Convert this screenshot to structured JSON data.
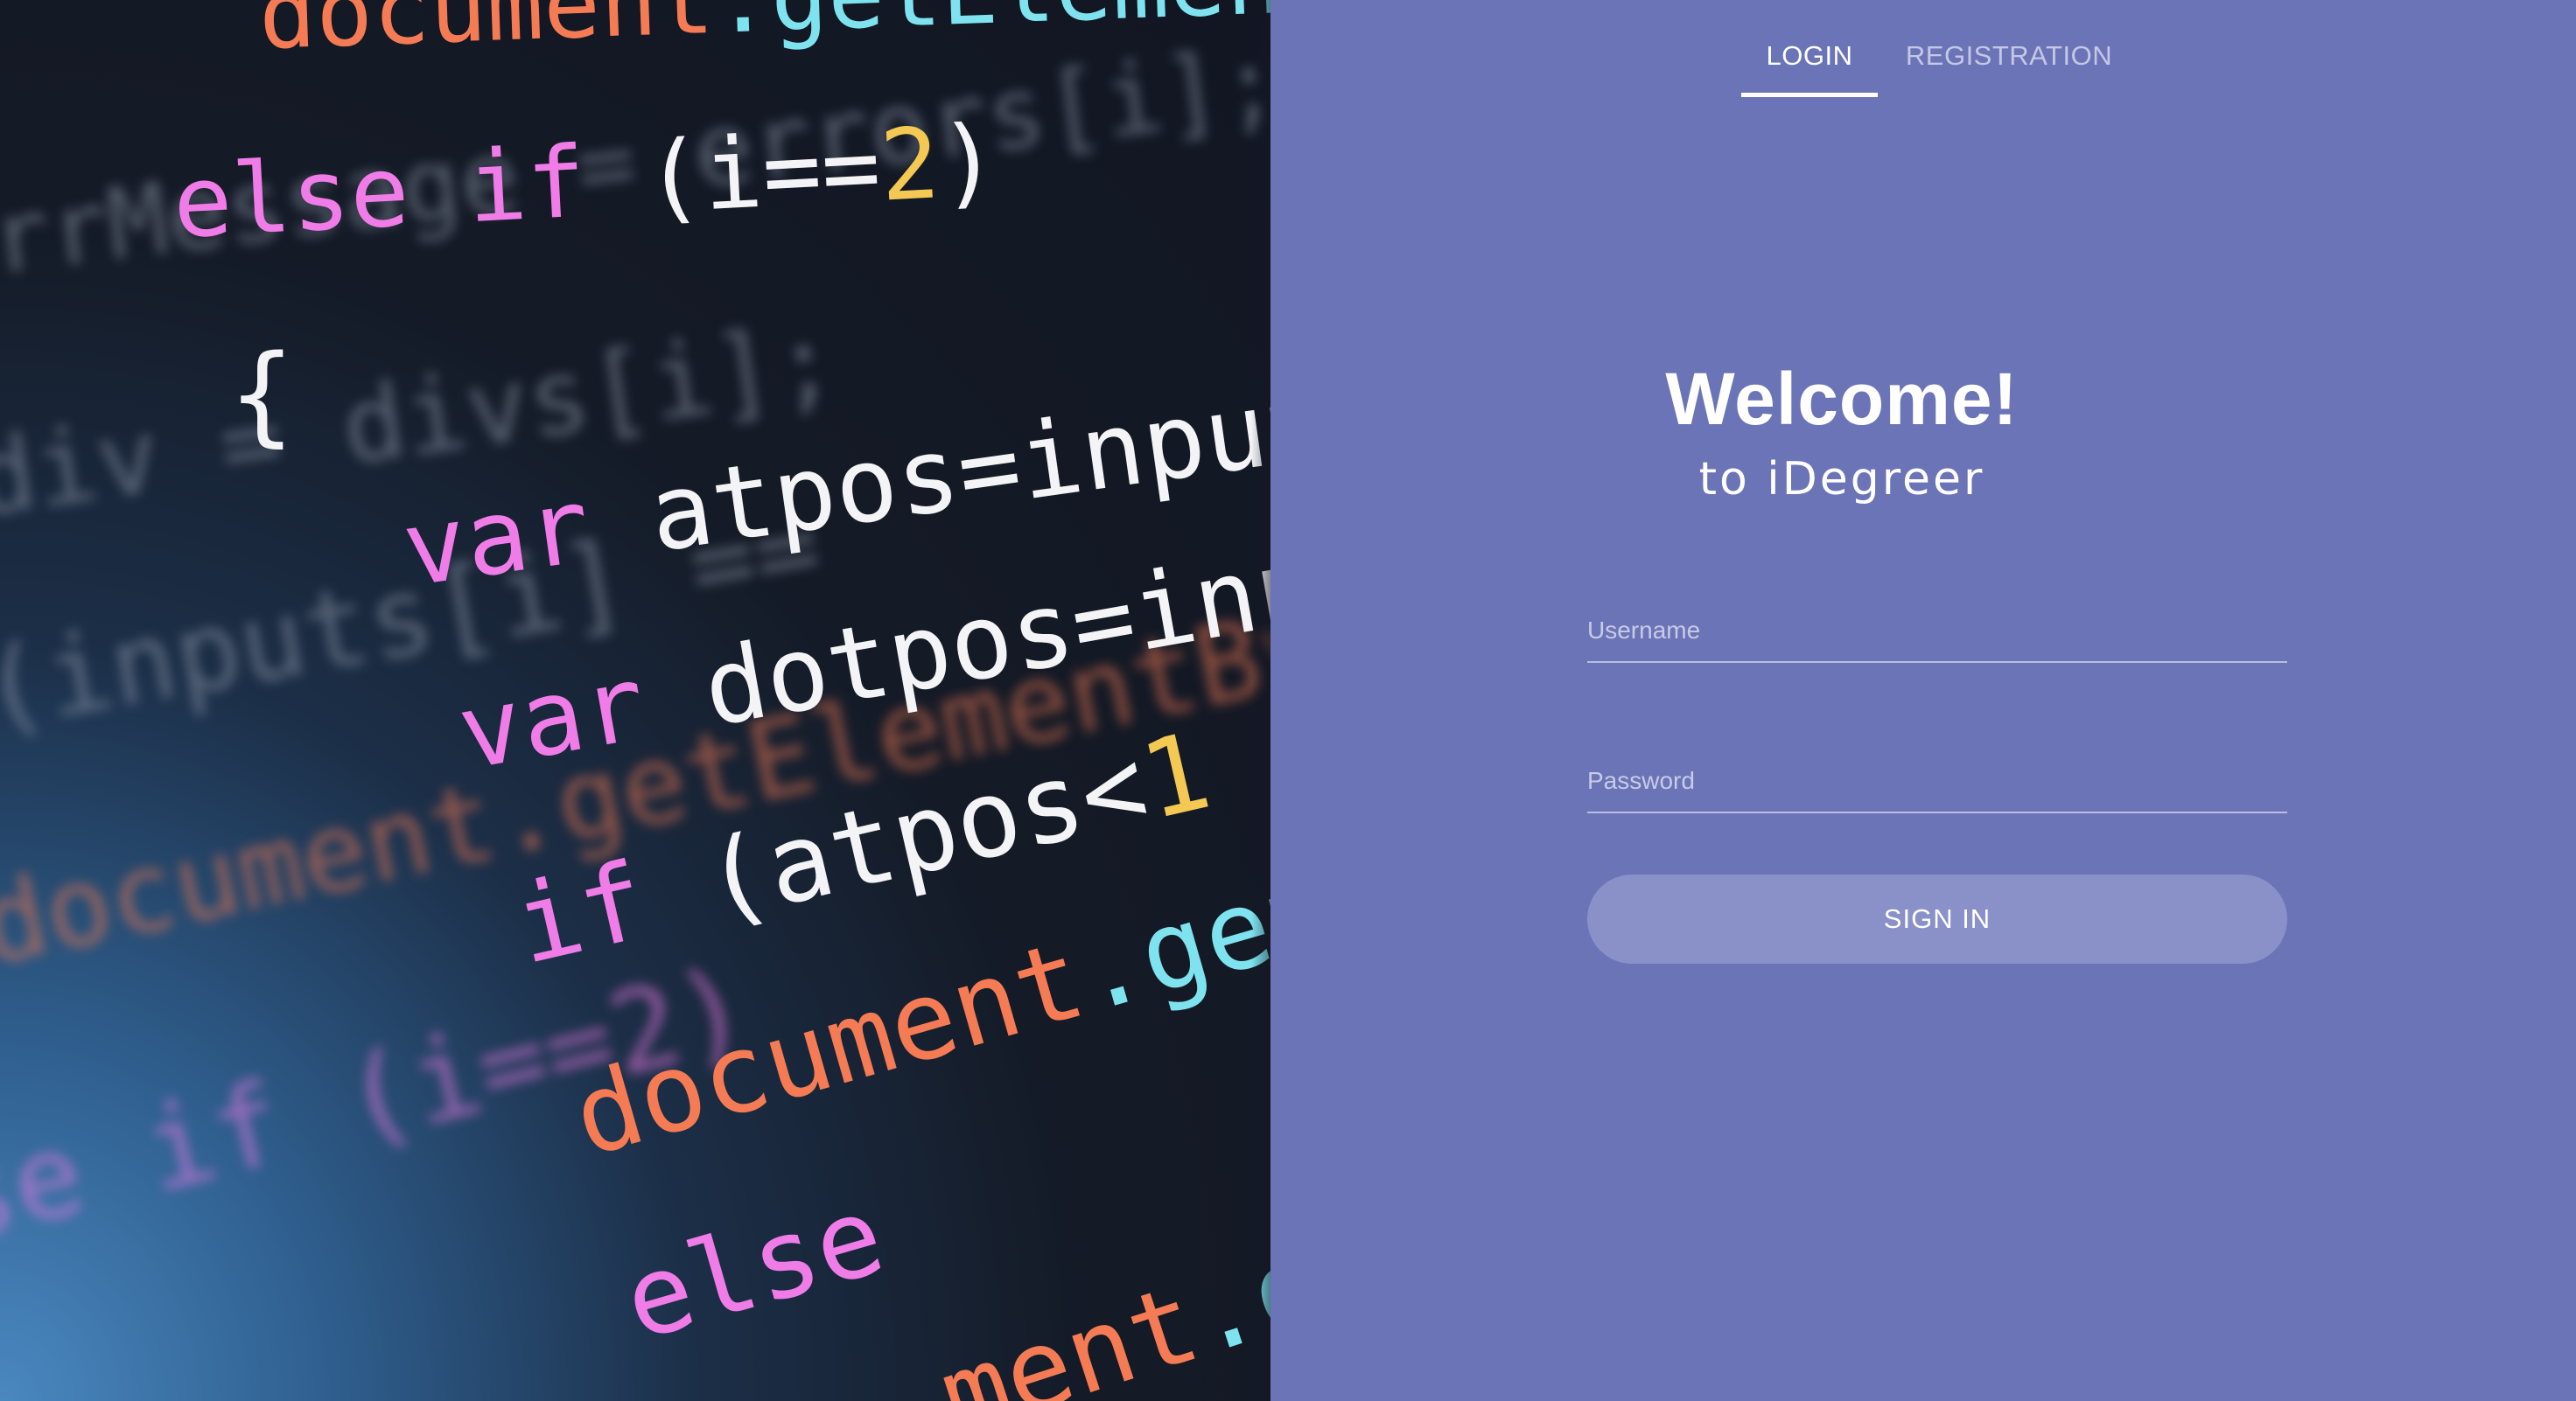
{
  "tabs": {
    "login_label": "LOGIN",
    "registration_label": "REGISTRATION"
  },
  "welcome": {
    "title": "Welcome!",
    "subtitle": "to iDegreer"
  },
  "form": {
    "username_placeholder": "Username",
    "password_placeholder": "Password",
    "signin_label": "SIGN IN"
  },
  "background_code": {
    "line1": {
      "a": "document",
      "b": ".getElementB"
    },
    "line2": {
      "a": "else if ",
      "b": "(i==",
      "c": "2",
      "d": ")"
    },
    "line3": {
      "a": "{"
    },
    "line4": {
      "a": "var ",
      "b": "atpos=inputs"
    },
    "line5": {
      "a": "var ",
      "b": "dotpos=inpu"
    },
    "line6": {
      "a": "if ",
      "b": "(atpos<",
      "c": "1",
      "d": " ||"
    },
    "line7": {
      "a": "document",
      "b": ".getE"
    },
    "line8": {
      "a": "else"
    },
    "line9": {
      "a": "ment",
      "b": ".ge"
    },
    "blur1": "rrMessage = errors[i];",
    "blur2": "div = divs[i];",
    "blur3": "(inputs[i] ==",
    "blur4": "document.getElementBy",
    "blur5": "se if (i==2)"
  },
  "colors": {
    "panel_background": "#6b74b6",
    "button_background": "#8a91c9",
    "tab_inactive": "#c4c8e6"
  }
}
